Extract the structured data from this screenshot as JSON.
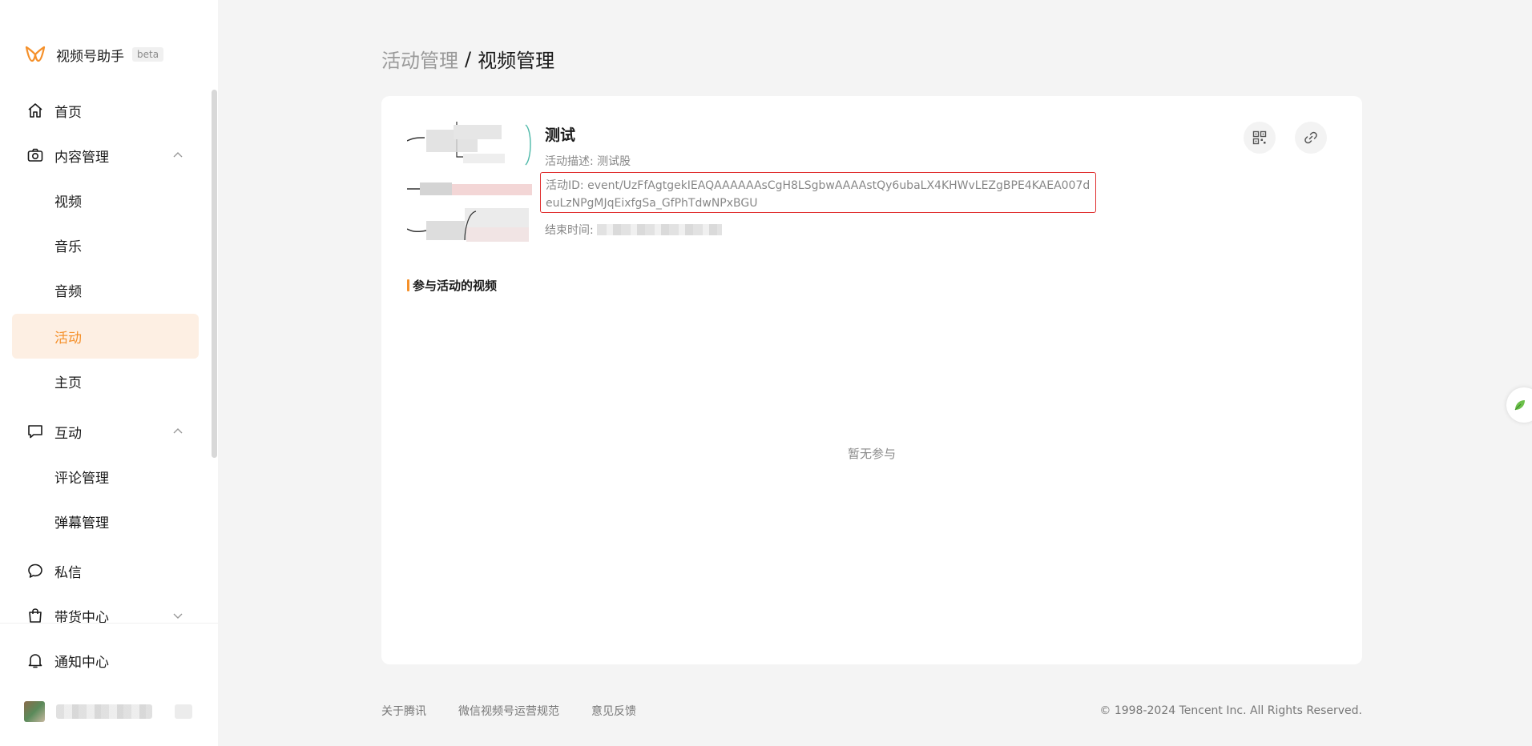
{
  "brand": {
    "name": "视频号助手",
    "badge": "beta"
  },
  "sidebar": {
    "items": [
      {
        "label": "首页",
        "icon": "home-icon"
      },
      {
        "label": "内容管理",
        "icon": "camera-icon",
        "expanded": true
      },
      {
        "label": "视频"
      },
      {
        "label": "音乐"
      },
      {
        "label": "音频"
      },
      {
        "label": "活动",
        "active": true
      },
      {
        "label": "主页"
      },
      {
        "label": "互动",
        "icon": "comment-icon",
        "expanded": true
      },
      {
        "label": "评论管理"
      },
      {
        "label": "弹幕管理"
      },
      {
        "label": "私信",
        "icon": "message-icon"
      },
      {
        "label": "带货中心",
        "icon": "bag-icon",
        "expanded": false
      }
    ],
    "notification": {
      "label": "通知中心",
      "icon": "bell-icon"
    }
  },
  "breadcrumb": {
    "parent": "活动管理",
    "separator": "/",
    "current": "视频管理"
  },
  "activity": {
    "title": "测试",
    "description": "活动描述: 测试股",
    "id_text": "活动ID: event/UzFfAgtgekIEAQAAAAAAsCgH8LSgbwAAAAstQy6ubaLX4KHWvLEZgBPE4KAEA007deuLzNPgMJqEixfgSa_GfPhTdwNPxBGU",
    "end_label": "结束时间:"
  },
  "section": {
    "title": "参与活动的视频",
    "empty": "暂无参与"
  },
  "footer": {
    "links": [
      "关于腾讯",
      "微信视频号运营规范",
      "意见反馈"
    ],
    "copyright": "© 1998-2024 Tencent Inc. All Rights Reserved."
  },
  "colors": {
    "accent": "#f5902a",
    "active_bg": "#fdefe3",
    "highlight_border": "#e03030"
  }
}
